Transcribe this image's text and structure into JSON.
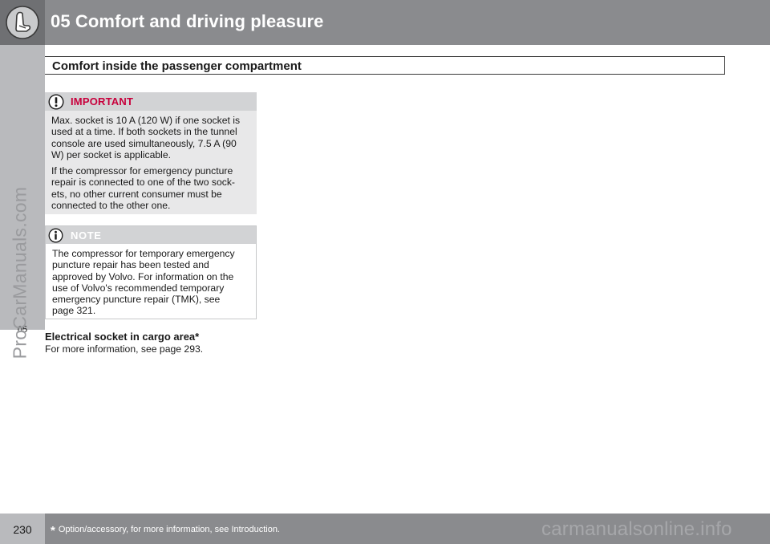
{
  "header": {
    "chapter_title": "05 Comfort and driving pleasure",
    "icon": "seat-icon"
  },
  "side_tab": {
    "chapter_number": "05"
  },
  "watermark": {
    "side_text": "ProCarManuals.com",
    "footer_text": "carmanualsonline.info"
  },
  "section": {
    "title": "Comfort inside the passenger compartment"
  },
  "important": {
    "icon": "warning-icon",
    "title": "IMPORTANT",
    "color": "#c8003c",
    "lines_p1": [
      "Max. socket is 10 A (120 W) if one socket is",
      "used at a time. If both sockets in the tunnel",
      "console are used simultaneously, 7.5 A (90",
      "W) per socket is applicable."
    ],
    "lines_p2": [
      "If the compressor for emergency puncture",
      "repair is connected to one of the two sock-",
      "ets, no other current consumer must be",
      "connected to the other one."
    ]
  },
  "note": {
    "icon": "info-icon",
    "title": "NOTE",
    "lines": [
      "The compressor for temporary emergency",
      "puncture repair has been tested and",
      "approved by Volvo. For information on the",
      "use of Volvo's recommended temporary",
      "emergency puncture repair (TMK), see",
      "page 321."
    ]
  },
  "electrical_socket": {
    "heading": "Electrical socket in cargo area*",
    "text": "For more information, see page 293."
  },
  "footer": {
    "page_number": "230",
    "footnote_marker": "*",
    "footnote_text": "Option/accessory, for more information, see Introduction."
  }
}
